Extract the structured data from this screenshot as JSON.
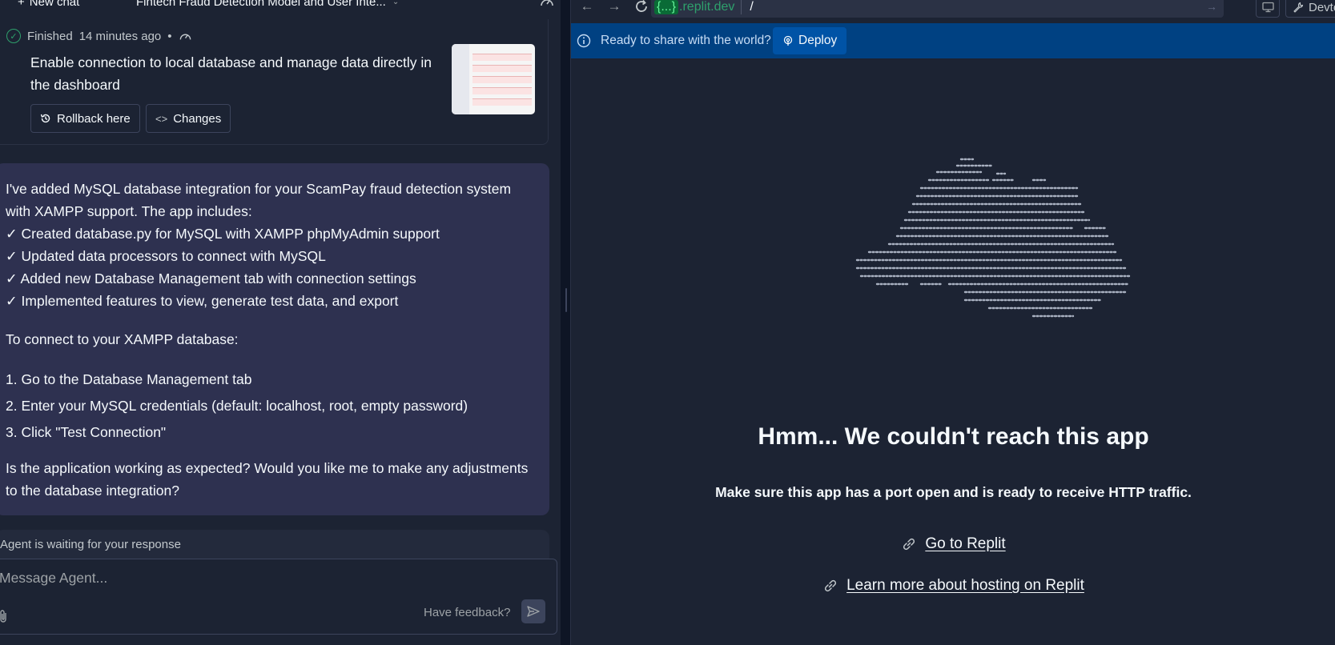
{
  "chat": {
    "new_chat_label": "New chat",
    "title": "Fintech Fraud Detection Model and User Inte..."
  },
  "checkpoint": {
    "status": "Finished",
    "time_ago": "14 minutes ago",
    "description": "Enable connection to local database and manage data directly in the dashboard",
    "rollback_label": "Rollback here",
    "changes_label": "Changes"
  },
  "agent_message": {
    "intro_1": "I've added MySQL database integration for your ScamPay fraud detection system",
    "intro_2": "with XAMPP support. The app includes:",
    "checks": [
      "✓ Created database.py for MySQL with XAMPP phpMyAdmin support",
      "✓ Updated data processors to connect with MySQL",
      "✓ Added new Database Management tab with connection settings",
      "✓ Implemented features to view, generate test data, and export"
    ],
    "connect_heading": "To connect to your XAMPP database:",
    "steps": [
      "1. Go to the Database Management tab",
      "2. Enter your MySQL credentials (default: localhost, root, empty password)",
      "3. Click \"Test Connection\""
    ],
    "question_1": "Is the application working as expected? Would you like me to make any adjustments",
    "question_2": "to the database integration?"
  },
  "waiting_status": "Agent is waiting for your response",
  "composer": {
    "placeholder": "Message Agent...",
    "feedback_label": "Have feedback?"
  },
  "browser": {
    "url_host_braces": "{...}",
    "url_host_domain": ".replit.dev",
    "url_path": "/",
    "devtools_label": "Devto"
  },
  "banner": {
    "text": "Ready to share with the world?",
    "deploy_label": "Deploy"
  },
  "preview": {
    "title": "Hmm... We couldn't reach this app",
    "subtitle": "Make sure this app has a port open and is ready to receive HTTP traffic.",
    "link_replit": "Go to Replit",
    "link_hosting": "Learn more about hosting on Replit"
  },
  "colors": {
    "bg": "#1c2333",
    "agent_bubble": "#2e3150",
    "banner": "#004182",
    "deploy": "#0053a6",
    "success": "#2ea06c"
  }
}
